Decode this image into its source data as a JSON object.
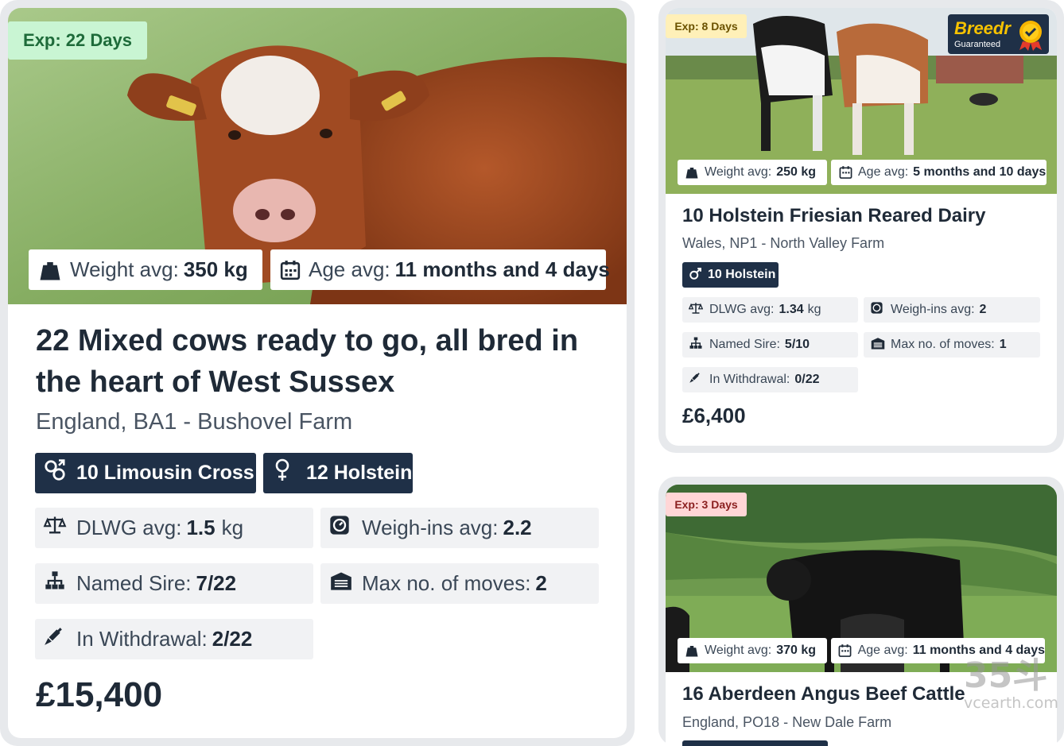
{
  "colors": {
    "navy": "#1f3047",
    "stat_bg": "#f1f2f4",
    "text": "#1f2a37"
  },
  "cards": [
    {
      "expiry": "Exp: 22 Days",
      "weight_label": "Weight avg:",
      "weight_value": "350 kg",
      "age_label": "Age avg:",
      "age_value": "11 months and 4 days",
      "title_line1": "22 Mixed cows ready to go, all bred in",
      "title_line2": "the heart of West Sussex",
      "location": "England, BA1 - Bushovel Farm",
      "tags": [
        "10 Limousin Cross",
        "12 Holstein"
      ],
      "dlwg_label": "DLWG avg:",
      "dlwg_value": "1.5",
      "dlwg_unit": "kg",
      "weighins_label": "Weigh-ins avg:",
      "weighins_value": "2.2",
      "sire_label": "Named Sire:",
      "sire_value": "7/22",
      "moves_label": "Max no. of moves:",
      "moves_value": "2",
      "withdrawal_label": "In Withdrawal:",
      "withdrawal_value": "2/22",
      "price": "£15,400"
    },
    {
      "expiry": "Exp: 8 Days",
      "badge_brand": "Breedr",
      "badge_sub": "Guaranteed",
      "weight_label": "Weight avg:",
      "weight_value": "250 kg",
      "age_label": "Age avg:",
      "age_value": "5 months and 10 days",
      "title": "10 Holstein Friesian Reared Dairy",
      "location": "Wales, NP1 - North Valley Farm",
      "tags": [
        "10 Holstein"
      ],
      "dlwg_label": "DLWG avg:",
      "dlwg_value": "1.34",
      "dlwg_unit": "kg",
      "weighins_label": "Weigh-ins avg:",
      "weighins_value": "2",
      "sire_label": "Named Sire:",
      "sire_value": "5/10",
      "moves_label": "Max no. of moves:",
      "moves_value": "1",
      "withdrawal_label": "In Withdrawal:",
      "withdrawal_value": "0/22",
      "price": "£6,400"
    },
    {
      "expiry": "Exp: 3 Days",
      "weight_label": "Weight avg:",
      "weight_value": "370 kg",
      "age_label": "Age avg:",
      "age_value": "11 months and 4 days",
      "title": "16 Aberdeen Angus Beef Cattle",
      "location": "England, PO18 - New Dale Farm"
    }
  ],
  "watermark": {
    "big": "35斗",
    "small": "vcearth.com"
  }
}
